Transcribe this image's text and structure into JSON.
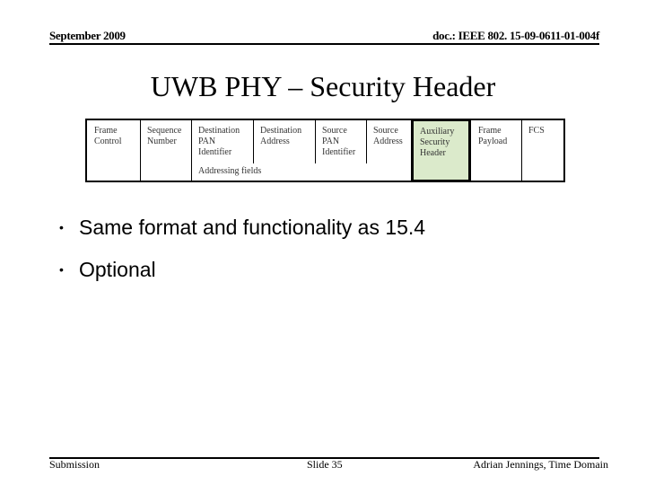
{
  "header": {
    "date": "September 2009",
    "doc_id": "doc.: IEEE 802. 15-09-0611-01-004f"
  },
  "title": "UWB PHY – Security Header",
  "frame_table": {
    "fields": [
      {
        "label": "Frame\nControl"
      },
      {
        "label": "Sequence\nNumber"
      },
      {
        "label": "Destination\nPAN\nIdentifier"
      },
      {
        "label": "Destination\nAddress"
      },
      {
        "label": "Source\nPAN\nIdentifier"
      },
      {
        "label": "Source\nAddress"
      },
      {
        "label": "Auxiliary\nSecurity\nHeader",
        "highlighted": true
      },
      {
        "label": "Frame\nPayload"
      },
      {
        "label": "FCS"
      }
    ],
    "group_label": "Addressing fields",
    "highlight_color": "#dbeacb"
  },
  "bullets": [
    "Same format and functionality as 15.4",
    "Optional"
  ],
  "bullet_glyph": "•",
  "footer": {
    "left": "Submission",
    "center": "Slide 35",
    "right": "Adrian Jennings, Time Domain"
  }
}
